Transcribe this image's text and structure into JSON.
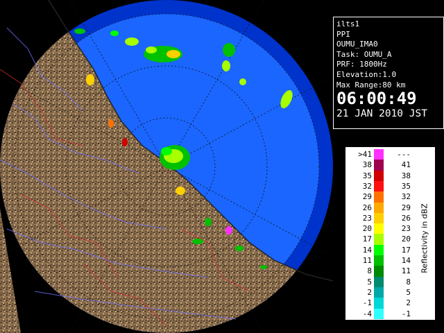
{
  "info": {
    "site": "ilts1",
    "product": "PPI",
    "radar_id": "OUMU_IMA0",
    "task": "Task: OUMU_A",
    "prf": "PRF: 1800Hz",
    "elevation": "Elevation:1.0",
    "max_range": "Max Range:80 km",
    "time": "06:00:49",
    "date": "21 JAN 2010 JST"
  },
  "legend": {
    "title": "Reflectivity in dBZ",
    "rows": [
      {
        "lo": ">41",
        "hi": "---",
        "color": "#ff30ff"
      },
      {
        "lo": "38",
        "hi": "41",
        "color": "#a00050"
      },
      {
        "lo": "35",
        "hi": "38",
        "color": "#d00000"
      },
      {
        "lo": "32",
        "hi": "35",
        "color": "#ff1010"
      },
      {
        "lo": "29",
        "hi": "32",
        "color": "#ff7000"
      },
      {
        "lo": "26",
        "hi": "29",
        "color": "#ffa800"
      },
      {
        "lo": "23",
        "hi": "26",
        "color": "#ffd000"
      },
      {
        "lo": "20",
        "hi": "23",
        "color": "#ffff00"
      },
      {
        "lo": "17",
        "hi": "20",
        "color": "#a8ff00"
      },
      {
        "lo": "14",
        "hi": "17",
        "color": "#00ff00"
      },
      {
        "lo": "11",
        "hi": "14",
        "color": "#00c000"
      },
      {
        "lo": "8",
        "hi": "11",
        "color": "#008a00"
      },
      {
        "lo": "5",
        "hi": "8",
        "color": "#008a6e"
      },
      {
        "lo": "2",
        "hi": "5",
        "color": "#00a8a8"
      },
      {
        "lo": "-1",
        "hi": "2",
        "color": "#00d8d8"
      },
      {
        "lo": "-4",
        "hi": "-1",
        "color": "#30ffff"
      }
    ]
  },
  "colors": {
    "sea_near": "#1a66ff",
    "sea_far": "#0033cc",
    "land": "#8c7050",
    "background": "#000000"
  }
}
